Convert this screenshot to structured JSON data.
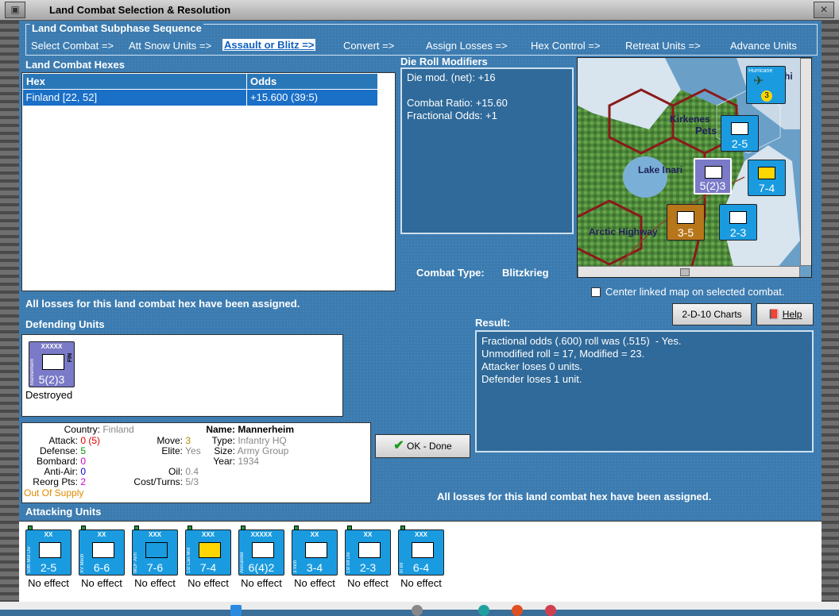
{
  "window": {
    "title": "Land Combat Selection & Resolution"
  },
  "sequence": {
    "header": "Land Combat Subphase Sequence",
    "steps": [
      "Select Combat =>",
      "Att Snow Units =>",
      "Assault or Blitz =>",
      "Convert =>",
      "Assign Losses =>",
      "Hex Control =>",
      "Retreat Units =>",
      "Advance Units"
    ],
    "selected": "Assault or Blitz =>"
  },
  "combat_hexes": {
    "header": "Land Combat Hexes",
    "columns": [
      "Hex",
      "Odds"
    ],
    "rows": [
      {
        "hex": "Finland [22, 52]",
        "odds": "+15.600 (39:5)"
      }
    ]
  },
  "die_roll": {
    "header": "Die Roll Modifiers",
    "text": "Die mod. (net): +16\n\nCombat Ratio: +15.60\nFractional Odds: +1"
  },
  "combat_type": {
    "label": "Combat Type:",
    "value": "Blitzkrieg"
  },
  "map": {
    "labels": {
      "kirkenes": "Kirkenes",
      "pets": "Pets",
      "lake": "Lake Inari",
      "highway": "Arctic Highway",
      "hurricane": "Hurricane",
      "hi": "hi"
    },
    "center_checkbox": "Center linked map on selected combat."
  },
  "status_top": "All losses for this land combat hex have been assigned.",
  "status_bottom": "All losses for this land combat hex have been assigned.",
  "buttons": {
    "charts": "2-D-10 Charts",
    "help": "Help",
    "ok": "OK - Done"
  },
  "result": {
    "header": "Result:",
    "text": "Fractional odds (.600) roll was (.515)  - Yes.\nUnmodified roll = 17, Modified = 23.\nAttacker loses 0 units.\nDefender loses 1 unit."
  },
  "defending": {
    "header": "Defending Units",
    "unit": {
      "size": "XXXXX",
      "name": "Mannerheim",
      "nation": "FIN",
      "value": "5(2)3",
      "status": "Destroyed"
    }
  },
  "unit_info": {
    "country_k": "Country:",
    "country_v": "Finland",
    "attack_k": "Attack:",
    "attack_v": "0",
    "attack_v2": "(5)",
    "defense_k": "Defense:",
    "defense_v": "5",
    "bombard_k": "Bombard:",
    "bombard_v": "0",
    "antiair_k": "Anti-Air:",
    "antiair_v": "0",
    "reorg_k": "Reorg Pts:",
    "reorg_v": "2",
    "supply": "Out Of Supply",
    "move_k": "Move:",
    "move_v": "3",
    "elite_k": "Elite:",
    "elite_v": "Yes",
    "oil_k": "Oil:",
    "oil_v": "0.4",
    "cost_k": "Cost/Turns:",
    "cost_v": "5/3",
    "name_k": "Name:",
    "name_v": "Mannerheim",
    "type_k": "Type:",
    "type_v": "Infantry HQ",
    "size_k": "Size:",
    "size_v": "Army Group",
    "year_k": "Year:",
    "year_v": "1934"
  },
  "attacking": {
    "header": "Attacking Units",
    "units": [
      {
        "size": "XX",
        "name": "50th Mot Div",
        "value": "2-5",
        "effect": "No effect"
      },
      {
        "size": "XX",
        "name": "XV Mech",
        "value": "6-6",
        "effect": "No effect"
      },
      {
        "size": "XXX",
        "name": "WDF Arm",
        "value": "7-6",
        "effect": "No effect"
      },
      {
        "size": "XXX",
        "name": "1st Can Mot",
        "value": "7-4",
        "effect": "No effect"
      },
      {
        "size": "XXXXX",
        "name": "Alexander",
        "value": "6(4)2",
        "effect": "No effect"
      },
      {
        "size": "XX",
        "name": "3 Inch",
        "value": "3-4",
        "effect": "No effect"
      },
      {
        "size": "XX",
        "name": "1st Inf Div",
        "value": "2-3",
        "effect": "No effect"
      },
      {
        "size": "XXX",
        "name": "III Inf",
        "value": "6-4",
        "effect": "No effect"
      }
    ]
  },
  "colors": {
    "panel_blue": "#3b7bb0",
    "selected_row": "#1a6fc7",
    "counter_blue": "#1a9be0",
    "counter_purple": "#7a7ac8"
  }
}
